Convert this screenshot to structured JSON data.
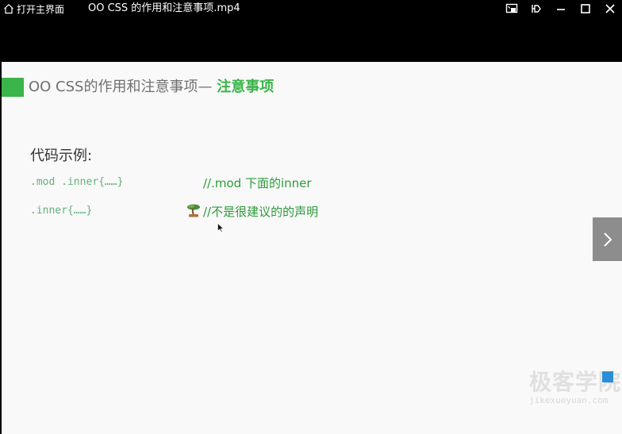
{
  "titlebar": {
    "home_label": "打开主界面",
    "file_title": "OO CSS 的作用和注意事项.mp4"
  },
  "slide": {
    "heading_main": "OO CSS的作用和注意事项— ",
    "heading_highlight": "注意事项",
    "example_label": "代码示例:",
    "code_lines": [
      {
        "code": ".mod .inner{……}",
        "comment": "//.mod 下面的inner"
      },
      {
        "code": ".inner{……}",
        "comment": "//不是很建议的的声明"
      }
    ]
  },
  "watermark": {
    "main": "极客学院",
    "sub": "jikexueyuan.com"
  },
  "icons": {
    "home": "home-icon",
    "pip": "picture-in-picture-icon",
    "pin": "pin-icon",
    "minimize": "minimize-icon",
    "maximize": "maximize-icon",
    "close": "close-icon",
    "next": "chevron-right-icon",
    "tree": "bonsai-tree-icon"
  },
  "colors": {
    "accent": "#3bb54a",
    "slide_bg": "#f9f9f9"
  }
}
